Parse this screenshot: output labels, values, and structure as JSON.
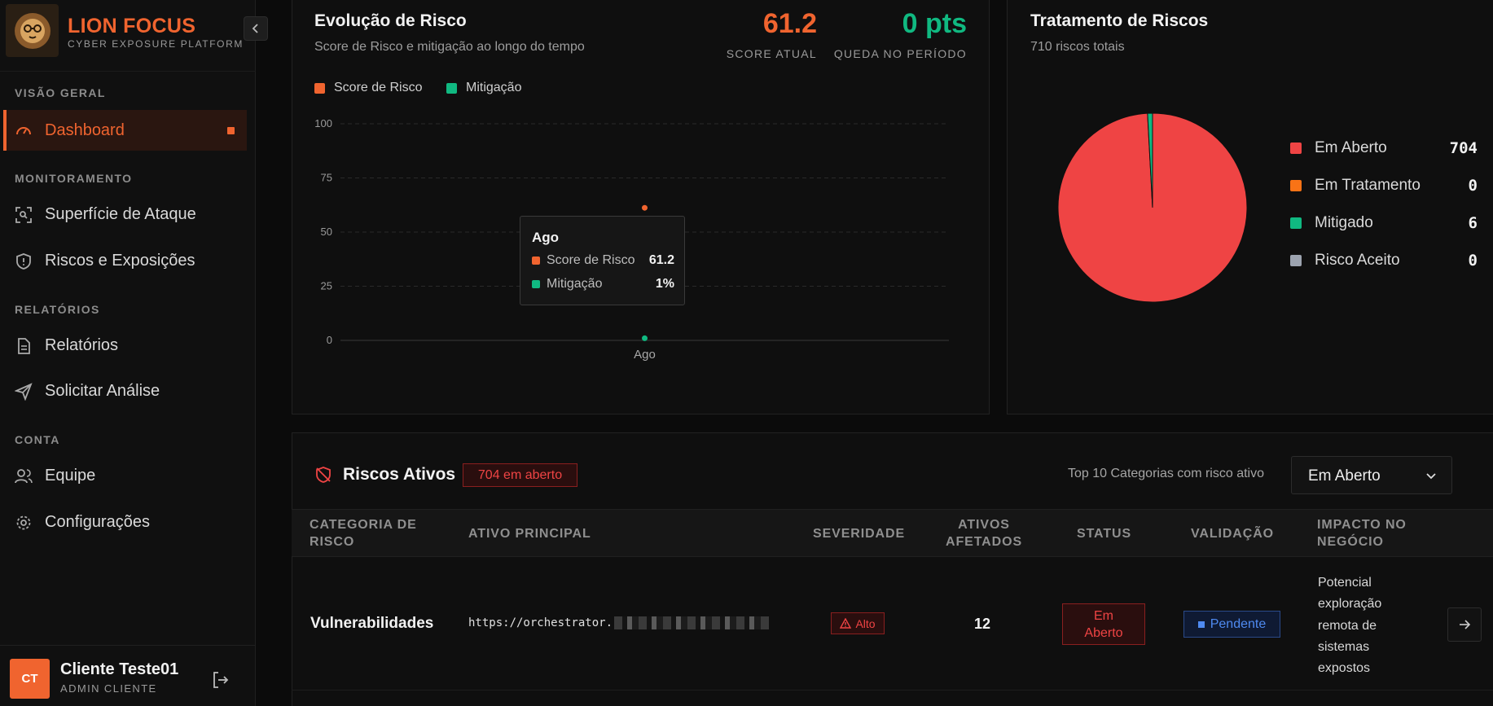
{
  "brand": {
    "title": "LION FOCUS",
    "subtitle": "CYBER EXPOSURE PLATFORM",
    "accent": "#f0642f"
  },
  "sidebar": {
    "sections": [
      {
        "label": "VISÃO GERAL",
        "items": [
          {
            "label": "Dashboard",
            "icon": "gauge-icon",
            "active": true
          }
        ]
      },
      {
        "label": "MONITORAMENTO",
        "items": [
          {
            "label": "Superfície de Ataque",
            "icon": "scan-icon"
          },
          {
            "label": "Riscos e Exposições",
            "icon": "shield-icon"
          }
        ]
      },
      {
        "label": "RELATÓRIOS",
        "items": [
          {
            "label": "Relatórios",
            "icon": "document-icon"
          },
          {
            "label": "Solicitar Análise",
            "icon": "send-icon"
          }
        ]
      },
      {
        "label": "CONTA",
        "items": [
          {
            "label": "Equipe",
            "icon": "users-icon"
          },
          {
            "label": "Configurações",
            "icon": "gear-icon"
          }
        ]
      }
    ]
  },
  "user": {
    "initials": "CT",
    "name": "Cliente Teste01",
    "role": "ADMIN CLIENTE"
  },
  "risk_evolution": {
    "title": "Evolução de Risco",
    "subtitle": "Score de Risco e mitigação ao longo do tempo",
    "score_value": "61.2",
    "score_label": "SCORE ATUAL",
    "drop_value": "0 pts",
    "drop_label": "QUEDA NO PERÍODO",
    "legend": [
      "Score de Risco",
      "Mitigação"
    ],
    "tooltip": {
      "title": "Ago",
      "rows": [
        {
          "label": "Score de Risco",
          "value": "61.2"
        },
        {
          "label": "Mitigação",
          "value": "1%"
        }
      ]
    }
  },
  "chart_data": [
    {
      "type": "line",
      "x": [
        "Ago"
      ],
      "series": [
        {
          "name": "Score de Risco",
          "values": [
            61.2
          ],
          "color": "#f0642f"
        },
        {
          "name": "Mitigação",
          "values": [
            1
          ],
          "color": "#10b981"
        }
      ],
      "ylim": [
        0,
        100
      ],
      "yticks": [
        "100",
        "75",
        "50",
        "25",
        "0"
      ],
      "grid": true
    },
    {
      "type": "pie",
      "categories": [
        "Em Aberto",
        "Em Tratamento",
        "Mitigado",
        "Risco Aceito"
      ],
      "values": [
        704,
        0,
        6,
        0
      ],
      "colors": [
        "#ef4444",
        "#f97316",
        "#10b981",
        "#9ca3af"
      ]
    }
  ],
  "treatment": {
    "title": "Tratamento de Riscos",
    "subtitle": "710 riscos totais",
    "legend": [
      {
        "label": "Em Aberto",
        "value": "704",
        "color": "#ef4444"
      },
      {
        "label": "Em Tratamento",
        "value": "0",
        "color": "#f97316"
      },
      {
        "label": "Mitigado",
        "value": "6",
        "color": "#10b981"
      },
      {
        "label": "Risco Aceito",
        "value": "0",
        "color": "#9ca3af"
      }
    ]
  },
  "active_risks": {
    "title": "Riscos Ativos",
    "badge": "704 em aberto",
    "filter_label": "Top 10 Categorias com risco ativo",
    "filter_value": "Em Aberto",
    "columns": {
      "category_1": "CATEGORIA DE",
      "category_2": "RISCO",
      "asset": "ATIVO PRINCIPAL",
      "severity": "SEVERIDADE",
      "affected_1": "ATIVOS",
      "affected_2": "AFETADOS",
      "status": "STATUS",
      "validation": "VALIDAÇÃO",
      "impact_1": "IMPACTO NO",
      "impact_2": "NEGÓCIO"
    },
    "rows": [
      {
        "category": "Vulnerabilidades",
        "asset": "https://orchestrator.",
        "severity": "Alto",
        "affected": "12",
        "status_1": "Em",
        "status_2": "Aberto",
        "validation": "Pendente",
        "impact_lines": [
          "Potencial",
          "exploração",
          "remota de",
          "sistemas",
          "expostos"
        ]
      }
    ]
  }
}
